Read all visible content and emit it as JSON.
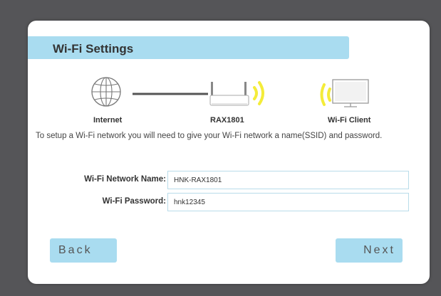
{
  "header": {
    "title": "Wi-Fi Settings"
  },
  "diagram": {
    "internet_label": "Internet",
    "router_label": "RAX1801",
    "client_label": "Wi-Fi Client",
    "signal_color": "#f4ec3a",
    "link_color": "#555555"
  },
  "intro_text": "To setup a Wi-Fi network you will need to give your Wi-Fi network a name(SSID) and password.",
  "form": {
    "network_name_label": "Wi-Fi Network Name:",
    "network_name_value": "HNK-RAX1801",
    "password_label": "Wi-Fi Password:",
    "password_value": "hnk12345"
  },
  "buttons": {
    "back_label": "Back",
    "next_label": "Next"
  },
  "colors": {
    "accent": "#a9dcf0",
    "background": "#555558"
  }
}
